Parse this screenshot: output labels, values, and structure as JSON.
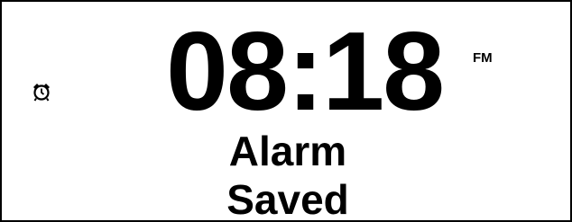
{
  "display": {
    "time": "08:18",
    "band": "FM",
    "message_line_1": "Alarm",
    "message_line_2": "Saved",
    "alarm_icon": "alarm-clock-icon"
  },
  "colors": {
    "background": "#ffffff",
    "foreground": "#000000"
  }
}
